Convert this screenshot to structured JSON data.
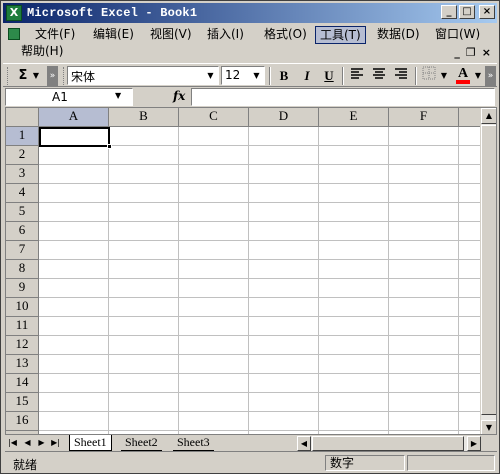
{
  "window": {
    "title": "Microsoft Excel - Book1",
    "icon": "excel-icon",
    "controls": [
      "_",
      "□",
      "×"
    ]
  },
  "menu": {
    "items": [
      {
        "label": "文件(F)"
      },
      {
        "label": "编辑(E)"
      },
      {
        "label": "视图(V)"
      },
      {
        "label": "插入(I)"
      },
      {
        "label": "格式(O)"
      },
      {
        "label": "工具(T)",
        "active": true
      },
      {
        "label": "数据(D)"
      },
      {
        "label": "窗口(W)"
      },
      {
        "label": "帮助(H)"
      }
    ],
    "doc_controls": [
      "_",
      "❐",
      "×"
    ]
  },
  "toolbar": {
    "autosum": "Σ",
    "font_name": "宋体",
    "font_size": "12",
    "bold": "B",
    "italic": "I",
    "underline": "U",
    "align_left": "align-left-icon",
    "align_center": "align-center-icon",
    "align_right": "align-right-icon",
    "borders": "borders-icon",
    "font_color_label": "A",
    "font_color": "#ff0000"
  },
  "formula": {
    "name_box": "A1",
    "fx": "fx",
    "value": ""
  },
  "grid": {
    "columns": [
      "A",
      "B",
      "C",
      "D",
      "E",
      "F"
    ],
    "rows": [
      "1",
      "2",
      "3",
      "4",
      "5",
      "6",
      "7",
      "8",
      "9",
      "10",
      "11",
      "12",
      "13",
      "14",
      "15",
      "16",
      "17"
    ],
    "active_cell": "A1"
  },
  "sheets": {
    "tabs": [
      "Sheet1",
      "Sheet2",
      "Sheet3"
    ],
    "active": "Sheet1"
  },
  "status": {
    "ready": "就绪",
    "num_lock": "数字"
  },
  "colors": {
    "title_start": "#0a246a",
    "title_end": "#a6caf0",
    "chrome": "#d4d0c8",
    "selection_header": "#b6bdd2"
  }
}
